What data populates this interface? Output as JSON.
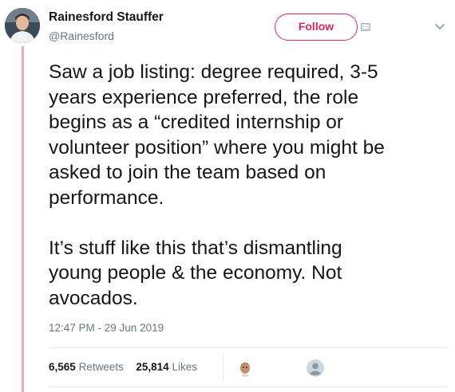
{
  "author": {
    "display_name": "Rainesford Stauffer",
    "handle": "@Rainesford"
  },
  "follow_button": {
    "label": "Follow"
  },
  "tweet": {
    "text": "Saw a job listing: degree required, 3-5\nyears experience preferred, the role\nbegins as a “credited internship or\nvolunteer position” where you might be\nasked to join the team based on\nperformance.\n\nIt’s stuff like this that’s dismantling\nyoung people & the economy. Not\navocados.",
    "timestamp": "12:47 PM - 29 Jun 2019"
  },
  "stats": {
    "retweets_count": "6,565",
    "retweets_label": "Retweets",
    "likes_count": "25,814",
    "likes_label": "Likes"
  },
  "colors": {
    "accent": "#e0245e",
    "thread_line": "#f4a9ad",
    "secondary_text": "#657786"
  },
  "icons": [
    "avatar",
    "card-icon",
    "chevron-down-icon",
    "liker-avatar",
    "default-profile-icon"
  ]
}
